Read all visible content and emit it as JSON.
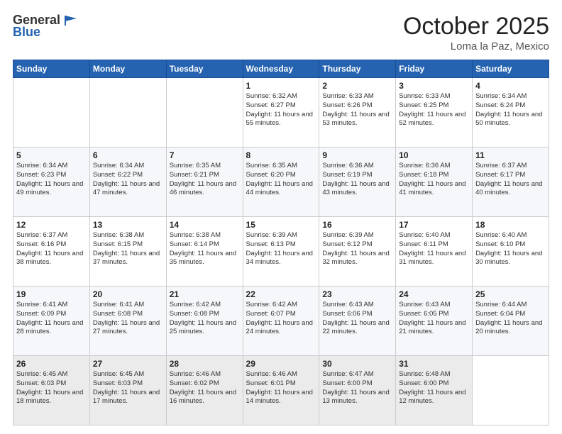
{
  "header": {
    "logo_general": "General",
    "logo_blue": "Blue",
    "month": "October 2025",
    "location": "Loma la Paz, Mexico"
  },
  "days_of_week": [
    "Sunday",
    "Monday",
    "Tuesday",
    "Wednesday",
    "Thursday",
    "Friday",
    "Saturday"
  ],
  "weeks": [
    [
      {
        "day": "",
        "sunrise": "",
        "sunset": "",
        "daylight": ""
      },
      {
        "day": "",
        "sunrise": "",
        "sunset": "",
        "daylight": ""
      },
      {
        "day": "",
        "sunrise": "",
        "sunset": "",
        "daylight": ""
      },
      {
        "day": "1",
        "sunrise": "Sunrise: 6:32 AM",
        "sunset": "Sunset: 6:27 PM",
        "daylight": "Daylight: 11 hours and 55 minutes."
      },
      {
        "day": "2",
        "sunrise": "Sunrise: 6:33 AM",
        "sunset": "Sunset: 6:26 PM",
        "daylight": "Daylight: 11 hours and 53 minutes."
      },
      {
        "day": "3",
        "sunrise": "Sunrise: 6:33 AM",
        "sunset": "Sunset: 6:25 PM",
        "daylight": "Daylight: 11 hours and 52 minutes."
      },
      {
        "day": "4",
        "sunrise": "Sunrise: 6:34 AM",
        "sunset": "Sunset: 6:24 PM",
        "daylight": "Daylight: 11 hours and 50 minutes."
      }
    ],
    [
      {
        "day": "5",
        "sunrise": "Sunrise: 6:34 AM",
        "sunset": "Sunset: 6:23 PM",
        "daylight": "Daylight: 11 hours and 49 minutes."
      },
      {
        "day": "6",
        "sunrise": "Sunrise: 6:34 AM",
        "sunset": "Sunset: 6:22 PM",
        "daylight": "Daylight: 11 hours and 47 minutes."
      },
      {
        "day": "7",
        "sunrise": "Sunrise: 6:35 AM",
        "sunset": "Sunset: 6:21 PM",
        "daylight": "Daylight: 11 hours and 46 minutes."
      },
      {
        "day": "8",
        "sunrise": "Sunrise: 6:35 AM",
        "sunset": "Sunset: 6:20 PM",
        "daylight": "Daylight: 11 hours and 44 minutes."
      },
      {
        "day": "9",
        "sunrise": "Sunrise: 6:36 AM",
        "sunset": "Sunset: 6:19 PM",
        "daylight": "Daylight: 11 hours and 43 minutes."
      },
      {
        "day": "10",
        "sunrise": "Sunrise: 6:36 AM",
        "sunset": "Sunset: 6:18 PM",
        "daylight": "Daylight: 11 hours and 41 minutes."
      },
      {
        "day": "11",
        "sunrise": "Sunrise: 6:37 AM",
        "sunset": "Sunset: 6:17 PM",
        "daylight": "Daylight: 11 hours and 40 minutes."
      }
    ],
    [
      {
        "day": "12",
        "sunrise": "Sunrise: 6:37 AM",
        "sunset": "Sunset: 6:16 PM",
        "daylight": "Daylight: 11 hours and 38 minutes."
      },
      {
        "day": "13",
        "sunrise": "Sunrise: 6:38 AM",
        "sunset": "Sunset: 6:15 PM",
        "daylight": "Daylight: 11 hours and 37 minutes."
      },
      {
        "day": "14",
        "sunrise": "Sunrise: 6:38 AM",
        "sunset": "Sunset: 6:14 PM",
        "daylight": "Daylight: 11 hours and 35 minutes."
      },
      {
        "day": "15",
        "sunrise": "Sunrise: 6:39 AM",
        "sunset": "Sunset: 6:13 PM",
        "daylight": "Daylight: 11 hours and 34 minutes."
      },
      {
        "day": "16",
        "sunrise": "Sunrise: 6:39 AM",
        "sunset": "Sunset: 6:12 PM",
        "daylight": "Daylight: 11 hours and 32 minutes."
      },
      {
        "day": "17",
        "sunrise": "Sunrise: 6:40 AM",
        "sunset": "Sunset: 6:11 PM",
        "daylight": "Daylight: 11 hours and 31 minutes."
      },
      {
        "day": "18",
        "sunrise": "Sunrise: 6:40 AM",
        "sunset": "Sunset: 6:10 PM",
        "daylight": "Daylight: 11 hours and 30 minutes."
      }
    ],
    [
      {
        "day": "19",
        "sunrise": "Sunrise: 6:41 AM",
        "sunset": "Sunset: 6:09 PM",
        "daylight": "Daylight: 11 hours and 28 minutes."
      },
      {
        "day": "20",
        "sunrise": "Sunrise: 6:41 AM",
        "sunset": "Sunset: 6:08 PM",
        "daylight": "Daylight: 11 hours and 27 minutes."
      },
      {
        "day": "21",
        "sunrise": "Sunrise: 6:42 AM",
        "sunset": "Sunset: 6:08 PM",
        "daylight": "Daylight: 11 hours and 25 minutes."
      },
      {
        "day": "22",
        "sunrise": "Sunrise: 6:42 AM",
        "sunset": "Sunset: 6:07 PM",
        "daylight": "Daylight: 11 hours and 24 minutes."
      },
      {
        "day": "23",
        "sunrise": "Sunrise: 6:43 AM",
        "sunset": "Sunset: 6:06 PM",
        "daylight": "Daylight: 11 hours and 22 minutes."
      },
      {
        "day": "24",
        "sunrise": "Sunrise: 6:43 AM",
        "sunset": "Sunset: 6:05 PM",
        "daylight": "Daylight: 11 hours and 21 minutes."
      },
      {
        "day": "25",
        "sunrise": "Sunrise: 6:44 AM",
        "sunset": "Sunset: 6:04 PM",
        "daylight": "Daylight: 11 hours and 20 minutes."
      }
    ],
    [
      {
        "day": "26",
        "sunrise": "Sunrise: 6:45 AM",
        "sunset": "Sunset: 6:03 PM",
        "daylight": "Daylight: 11 hours and 18 minutes."
      },
      {
        "day": "27",
        "sunrise": "Sunrise: 6:45 AM",
        "sunset": "Sunset: 6:03 PM",
        "daylight": "Daylight: 11 hours and 17 minutes."
      },
      {
        "day": "28",
        "sunrise": "Sunrise: 6:46 AM",
        "sunset": "Sunset: 6:02 PM",
        "daylight": "Daylight: 11 hours and 16 minutes."
      },
      {
        "day": "29",
        "sunrise": "Sunrise: 6:46 AM",
        "sunset": "Sunset: 6:01 PM",
        "daylight": "Daylight: 11 hours and 14 minutes."
      },
      {
        "day": "30",
        "sunrise": "Sunrise: 6:47 AM",
        "sunset": "Sunset: 6:00 PM",
        "daylight": "Daylight: 11 hours and 13 minutes."
      },
      {
        "day": "31",
        "sunrise": "Sunrise: 6:48 AM",
        "sunset": "Sunset: 6:00 PM",
        "daylight": "Daylight: 11 hours and 12 minutes."
      },
      {
        "day": "",
        "sunrise": "",
        "sunset": "",
        "daylight": ""
      }
    ]
  ]
}
